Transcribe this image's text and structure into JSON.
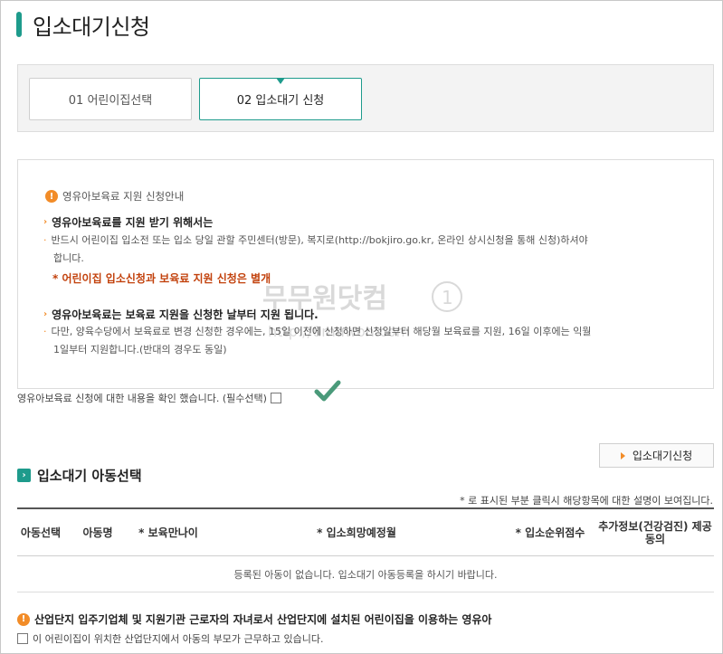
{
  "page": {
    "title": "입소대기신청"
  },
  "steps": [
    {
      "label": "01 어린이집선택",
      "active": false
    },
    {
      "label": "02 입소대기 신청",
      "active": true
    }
  ],
  "notice": {
    "heading": "영유아보육료 지원 신청안내",
    "section1": {
      "title": "영유아보육료를 지원 받기 위해서는",
      "line1": "반드시 어린이집 입소전 또는 입소 당일 관할 주민센터(방문), 복지로(http://bokjiro.go.kr, 온라인 상시신청을 통해 신청)하셔야",
      "line2": "합니다.",
      "emphasis": "* 어린이집 입소신청과 보육료 지원 신청은 별개"
    },
    "section2": {
      "title": "영유아보육료는 보육료 지원을 신청한 날부터 지원 됩니다.",
      "line1": "다만, 양육수당에서 보육료로 변경 신청한 경우에는, 15일 이전에 신청하면 신청일부터 해당월 보육료를 지원, 16일 이후에는 익월",
      "line2": "1일부터 지원합니다.(반대의 경우도 동일)"
    }
  },
  "watermark": {
    "text1": "무무원닷컴",
    "text2": "http://0muwon.com",
    "badge": "1"
  },
  "confirm": {
    "label": "영유아보육료 신청에 대한 내용을 확인 했습니다. (필수선택)"
  },
  "apply_button": {
    "label": "입소대기신청"
  },
  "section": {
    "title": "입소대기 아동선택"
  },
  "hint": "* 로 표시된 부분 클릭시 해당항목에 대한 설명이 보여집니다.",
  "table": {
    "columns": [
      "아동선택",
      "아동명",
      "* 보육만나이",
      "* 입소희망예정월",
      "* 입소순위점수",
      "추가정보(건강검진) 제공동의"
    ],
    "empty_message": "등록된 아동이 없습니다. 입소대기 아동등록을 하시기 바랍니다."
  },
  "industry": {
    "title": "산업단지 입주기업체 및 지원기관 근로자의 자녀로서 산업단지에 설치된 어린이집을 이용하는 영유아",
    "checkbox_label": "이 어린이집이 위치한 산업단지에서 아동의 부모가 근무하고 있습니다."
  },
  "colors": {
    "accent": "#1e9b8c",
    "warning": "#f28c28",
    "emphasis": "#c2410c"
  }
}
